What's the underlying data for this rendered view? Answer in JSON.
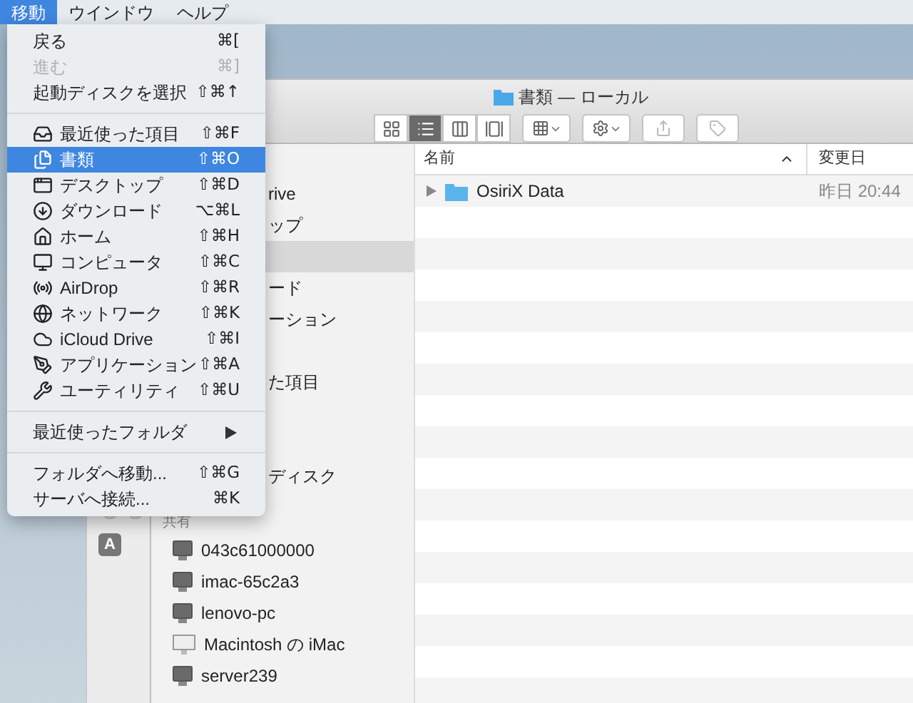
{
  "menubar": [
    {
      "label": "移動",
      "selected": true
    },
    {
      "label": "ウインドウ",
      "selected": false
    },
    {
      "label": "ヘルプ",
      "selected": false
    }
  ],
  "menu": {
    "sections": [
      {
        "items": [
          {
            "kind": "item",
            "label": "戻る",
            "shortcut": "⌘[",
            "disabled": false,
            "selected": false
          },
          {
            "kind": "item",
            "label": "進む",
            "shortcut": "⌘]",
            "disabled": true,
            "selected": false
          },
          {
            "kind": "item",
            "label": "起動ディスクを選択",
            "shortcut": "⇧⌘↑",
            "disabled": false,
            "selected": false
          }
        ]
      },
      {
        "items": [
          {
            "kind": "place",
            "label": "最近使った項目",
            "shortcut": "⇧⌘F",
            "disabled": false,
            "selected": false
          },
          {
            "kind": "place",
            "label": "書類",
            "shortcut": "⇧⌘O",
            "disabled": false,
            "selected": true
          },
          {
            "kind": "place",
            "label": "デスクトップ",
            "shortcut": "⇧⌘D",
            "disabled": false,
            "selected": false
          },
          {
            "kind": "place",
            "label": "ダウンロード",
            "shortcut": "⌥⌘L",
            "disabled": false,
            "selected": false
          },
          {
            "kind": "place",
            "label": "ホーム",
            "shortcut": "⇧⌘H",
            "disabled": false,
            "selected": false
          },
          {
            "kind": "place",
            "label": "コンピュータ",
            "shortcut": "⇧⌘C",
            "disabled": false,
            "selected": false
          },
          {
            "kind": "place",
            "label": "AirDrop",
            "shortcut": "⇧⌘R",
            "disabled": false,
            "selected": false
          },
          {
            "kind": "place",
            "label": "ネットワーク",
            "shortcut": "⇧⌘K",
            "disabled": false,
            "selected": false
          },
          {
            "kind": "place",
            "label": "iCloud Drive",
            "shortcut": "⇧⌘I",
            "disabled": false,
            "selected": false
          },
          {
            "kind": "place",
            "label": "アプリケーション",
            "shortcut": "⇧⌘A",
            "disabled": false,
            "selected": false
          },
          {
            "kind": "place",
            "label": "ユーティリティ",
            "shortcut": "⇧⌘U",
            "disabled": false,
            "selected": false
          }
        ]
      },
      {
        "items": [
          {
            "kind": "submenu",
            "label": "最近使ったフォルダ",
            "disabled": false,
            "selected": false
          }
        ]
      },
      {
        "items": [
          {
            "kind": "item",
            "label": "フォルダへ移動...",
            "shortcut": "⇧⌘G",
            "disabled": false,
            "selected": false
          },
          {
            "kind": "item",
            "label": "サーバへ接続...",
            "shortcut": "⌘K",
            "disabled": false,
            "selected": false
          }
        ]
      }
    ]
  },
  "back_window": {
    "badge": "A"
  },
  "finder": {
    "title": "書類 — ローカル",
    "view_buttons": [
      {
        "selected": false
      },
      {
        "selected": true
      },
      {
        "selected": false
      },
      {
        "selected": false
      }
    ],
    "sidebar": {
      "items": [
        {
          "label": "rive",
          "selected": false
        },
        {
          "label": "ップ",
          "selected": false
        },
        {
          "selected": true
        },
        {
          "label": "ード",
          "selected": false
        },
        {
          "label": "ーション",
          "selected": false
        },
        {
          "selected": false
        },
        {
          "label": "た項目",
          "selected": false
        },
        {
          "selected": false
        },
        {
          "selected": false
        },
        {
          "label": "ディスク",
          "selected": false
        }
      ],
      "shared": {
        "heading": "共有",
        "items": [
          {
            "label": "043c61000000",
            "kind": "display"
          },
          {
            "label": "imac-65c2a3",
            "kind": "display"
          },
          {
            "label": "lenovo-pc",
            "kind": "display"
          },
          {
            "label": "Macintosh の iMac",
            "kind": "imac"
          },
          {
            "label": "server239",
            "kind": "display"
          }
        ]
      }
    },
    "table": {
      "columns": [
        "名前",
        "変更日"
      ],
      "rows": [
        {
          "name": "OsiriX Data",
          "date": "昨日 20:44",
          "expanded": false
        }
      ]
    }
  }
}
